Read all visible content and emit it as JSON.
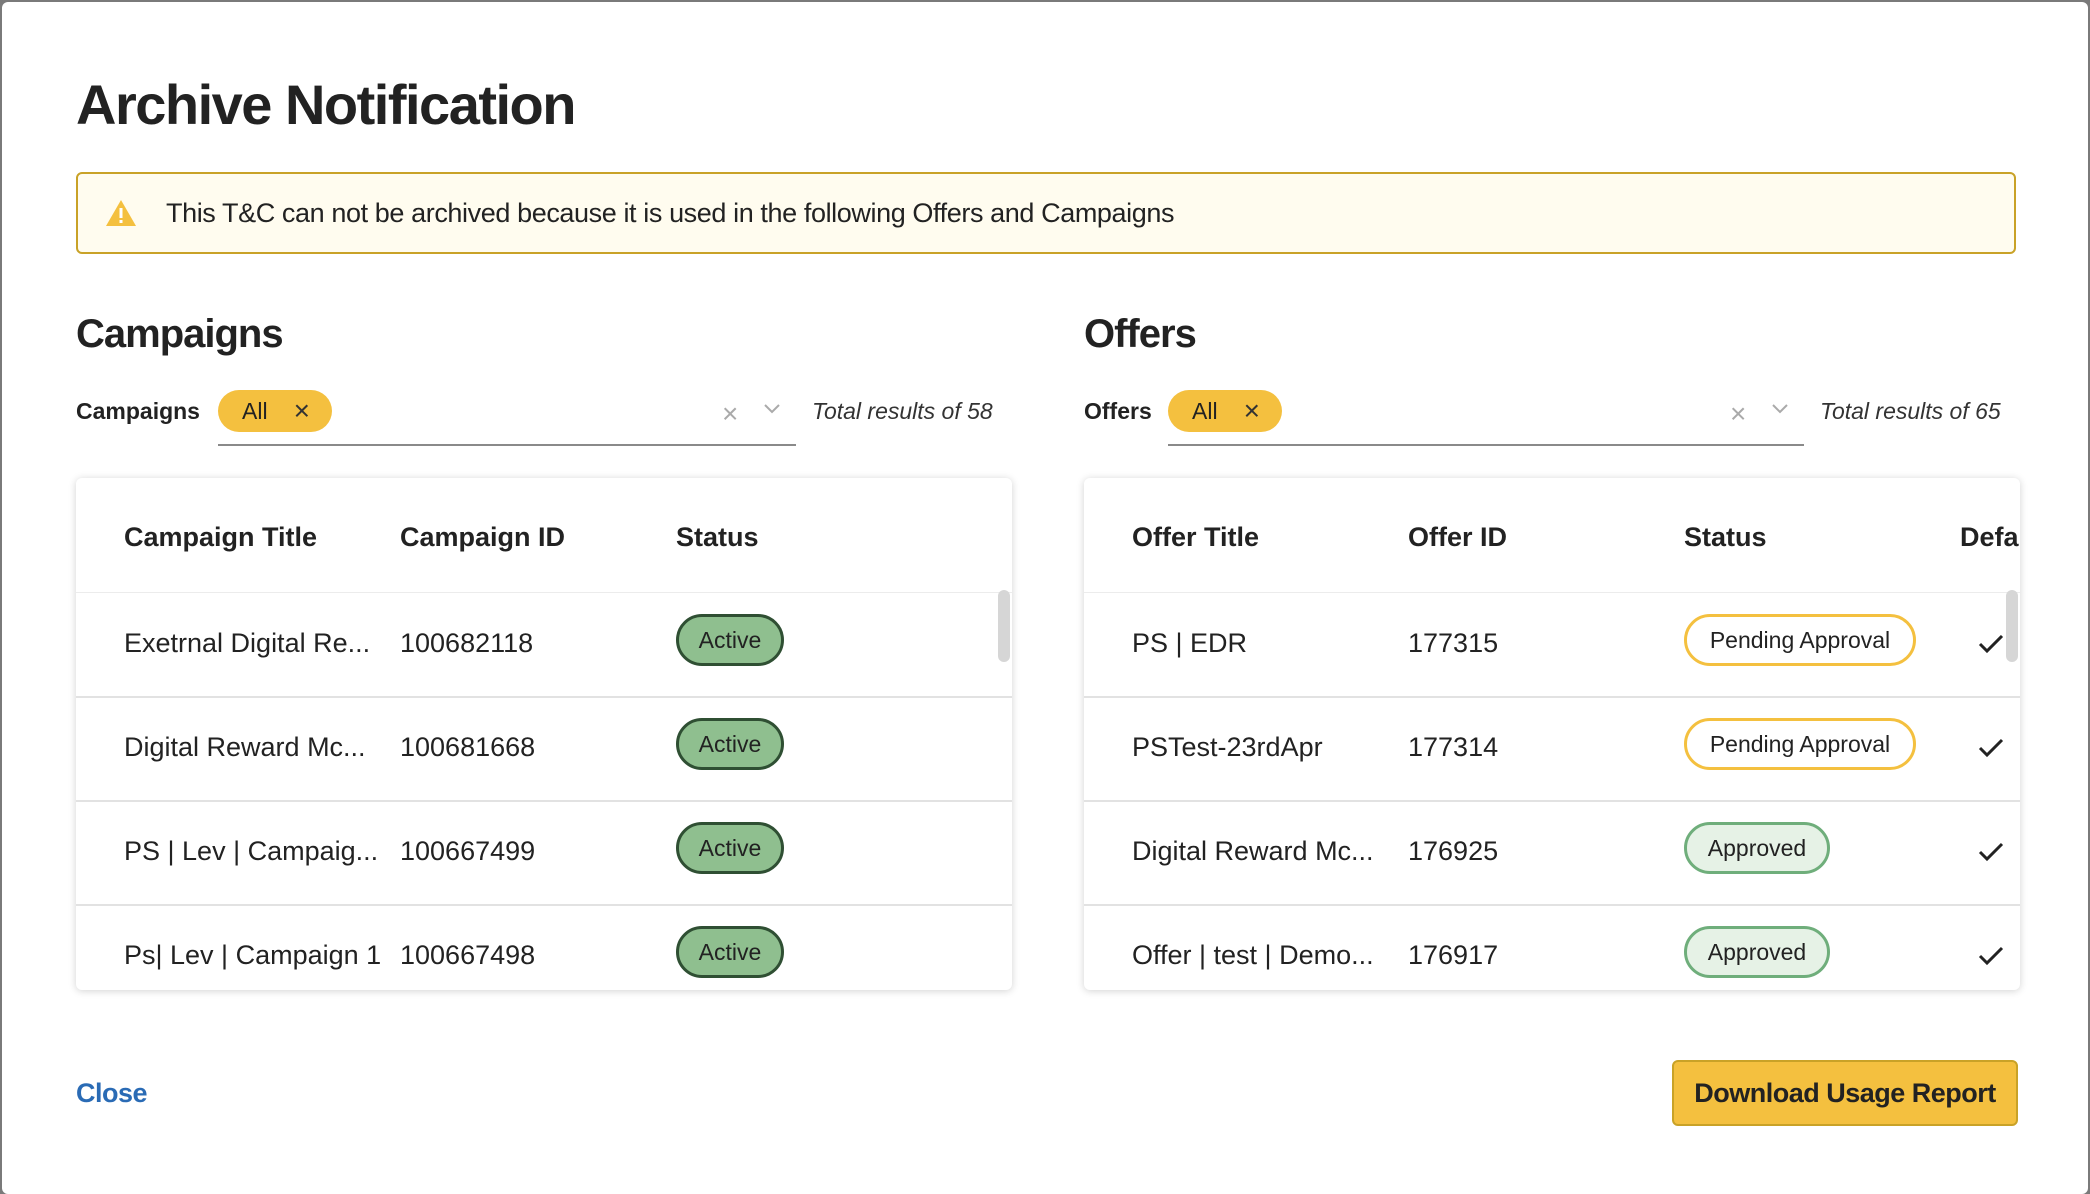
{
  "colors": {
    "accent_yellow": "#f4c03f",
    "link_blue": "#2a6bb5",
    "warning_border": "#c9a227",
    "active_green": "#8fbf8f",
    "approved_green": "#6fae7b"
  },
  "modal": {
    "title": "Archive Notification",
    "warning": {
      "icon": "warning-triangle-icon",
      "text": "This T&C can not be archived because it is used in the following Offers and Campaigns"
    },
    "close_label": "Close",
    "download_label": "Download Usage Report"
  },
  "campaigns": {
    "heading": "Campaigns",
    "filter_label": "Campaigns",
    "chip_label": "All",
    "total_text": "Total results of 58",
    "columns": [
      "Campaign Title",
      "Campaign ID",
      "Status"
    ],
    "rows": [
      {
        "title": "Exetrnal Digital Re...",
        "id": "100682118",
        "status": "Active"
      },
      {
        "title": "Digital Reward Mc...",
        "id": "100681668",
        "status": "Active"
      },
      {
        "title": "PS | Lev | Campaig...",
        "id": "100667499",
        "status": "Active"
      },
      {
        "title": "Ps| Lev | Campaign 1",
        "id": "100667498",
        "status": "Active"
      }
    ]
  },
  "offers": {
    "heading": "Offers",
    "filter_label": "Offers",
    "chip_label": "All",
    "total_text": "Total results of 65",
    "columns": [
      "Offer Title",
      "Offer ID",
      "Status",
      "Defa"
    ],
    "rows": [
      {
        "title": "PS | EDR",
        "id": "177315",
        "status": "Pending Approval",
        "default": "check"
      },
      {
        "title": "PSTest-23rdApr",
        "id": "177314",
        "status": "Pending Approval",
        "default": "check"
      },
      {
        "title": "Digital Reward Mc...",
        "id": "176925",
        "status": "Approved",
        "default": "check"
      },
      {
        "title": "Offer | test | Demo...",
        "id": "176917",
        "status": "Approved",
        "default": "check"
      }
    ]
  }
}
